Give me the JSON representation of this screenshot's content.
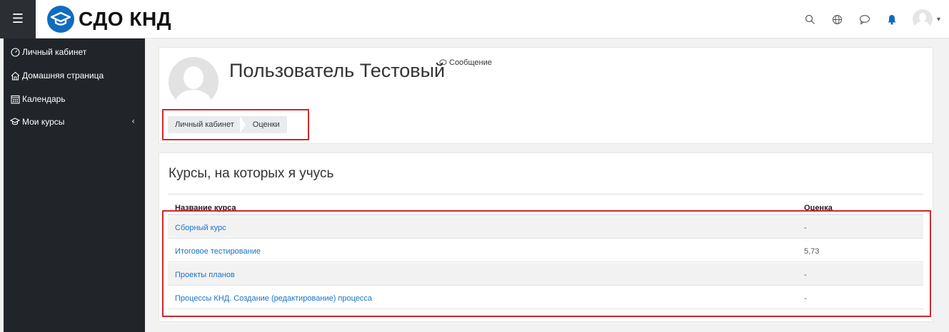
{
  "navbar": {
    "menu_icon": "hamburger-icon",
    "brand_name": "СДО КНД",
    "brand_logo": "graduation-cap-icon",
    "brand_color": "#0f6cbf",
    "icons": [
      "search-icon",
      "globe-icon",
      "chat-icon",
      "bell-icon",
      "user-avatar"
    ]
  },
  "sidebar": {
    "items": [
      {
        "label": "Личный кабинет",
        "icon": "dashboard-gauge-icon"
      },
      {
        "label": "Домашняя страница",
        "icon": "home-icon"
      },
      {
        "label": "Календарь",
        "icon": "calendar-icon"
      },
      {
        "label": "Мои курсы",
        "icon": "graduation-cap-icon"
      }
    ]
  },
  "profile": {
    "name": "Пользователь Тестовый",
    "message_label": "Сообщение"
  },
  "breadcrumb": {
    "items": [
      "Личный кабинет",
      "Оценки"
    ]
  },
  "courses": {
    "title": "Курсы, на которых я учусь",
    "columns": {
      "name": "Название курса",
      "grade": "Оценка"
    },
    "rows": [
      {
        "name": "Сборный курс",
        "grade": "-"
      },
      {
        "name": "Итоговое тестирование",
        "grade": "5,73"
      },
      {
        "name": "Проекты планов",
        "grade": "-"
      },
      {
        "name": "Процессы КНД. Создание (редактирование) процесса",
        "grade": "-"
      }
    ]
  },
  "highlight_color": "#d0272d"
}
